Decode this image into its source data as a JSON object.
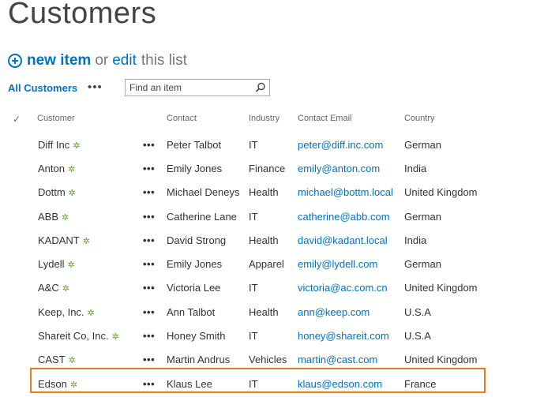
{
  "page": {
    "title": "Customers"
  },
  "command_bar": {
    "new_item": "new item",
    "or": "or",
    "edit": "edit",
    "this_list": "this list"
  },
  "view": {
    "name": "All Customers",
    "more": "•••",
    "search_placeholder": "Find an item"
  },
  "columns": {
    "customer": "Customer",
    "contact": "Contact",
    "industry": "Industry",
    "email": "Contact Email",
    "country": "Country"
  },
  "rows": [
    {
      "customer": "Diff Inc",
      "contact": "Peter Talbot",
      "industry": "IT",
      "email": "peter@diff.inc.com",
      "country": "German"
    },
    {
      "customer": "Anton",
      "contact": "Emily Jones",
      "industry": "Finance",
      "email": "emily@anton.com",
      "country": "India"
    },
    {
      "customer": "Dottm",
      "contact": "Michael Deneys",
      "industry": "Health",
      "email": "michael@bottm.local",
      "country": "United Kingdom"
    },
    {
      "customer": "ABB",
      "contact": "Catherine Lane",
      "industry": "IT",
      "email": "catherine@abb.com",
      "country": "German"
    },
    {
      "customer": "KADANT",
      "contact": "David Strong",
      "industry": "Health",
      "email": "david@kadant.local",
      "country": "India"
    },
    {
      "customer": "Lydell",
      "contact": "Emily Jones",
      "industry": "Apparel",
      "email": "emily@lydell.com",
      "country": "German"
    },
    {
      "customer": "A&C",
      "contact": "Victoria Lee",
      "industry": "IT",
      "email": "victoria@ac.com.cn",
      "country": "United Kingdom"
    },
    {
      "customer": "Keep, Inc.",
      "contact": "Ann Talbot",
      "industry": "Health",
      "email": "ann@keep.com",
      "country": "U.S.A"
    },
    {
      "customer": "Shareit Co, Inc.",
      "contact": "Honey Smith",
      "industry": "IT",
      "email": "honey@shareit.com",
      "country": "U.S.A"
    },
    {
      "customer": "CAST",
      "contact": "Martin Andrus",
      "industry": "Vehicles",
      "email": "martin@cast.com",
      "country": "United Kingdom"
    },
    {
      "customer": "Edson",
      "contact": "Klaus Lee",
      "industry": "IT",
      "email": "klaus@edson.com",
      "country": "France"
    }
  ],
  "row_menu": "•••",
  "new_marker": "✲",
  "colors": {
    "accent": "#0072c6",
    "new_marker": "#63a52f",
    "selection_outline": "#e07d21"
  }
}
